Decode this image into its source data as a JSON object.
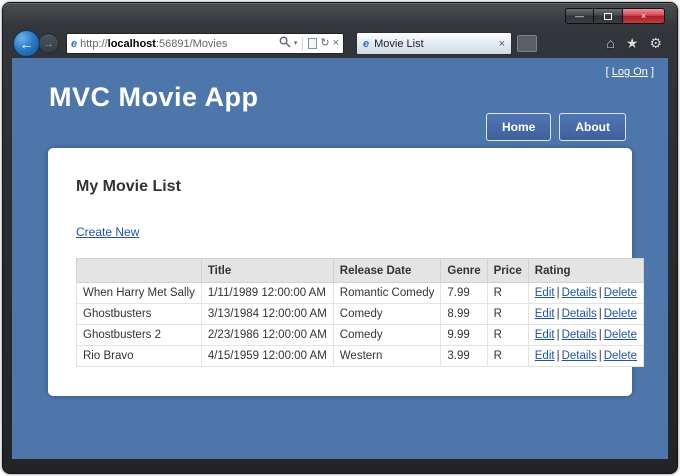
{
  "icons": {
    "minimize": "—",
    "close": "×",
    "back": "←",
    "forward": "→",
    "dropdown": "▾",
    "refresh": "↻",
    "stop": "×",
    "home": "⌂",
    "favorites": "★",
    "tools": "⚙",
    "tab_close": "×",
    "ie_favicon": "e"
  },
  "browser": {
    "address": {
      "protocol": "http://",
      "host": "localhost",
      "path": ":56891/Movies"
    },
    "tab_title": "Movie List"
  },
  "colors": {
    "page_background": "#4d76ab",
    "link_blue": "#2054a3",
    "nav_button": "#3f5f9b",
    "close_button_red": "#d4494f"
  },
  "page": {
    "logon": {
      "open": "[",
      "label": "Log On",
      "close": "]"
    },
    "app_title": "MVC Movie App",
    "nav": {
      "home": "Home",
      "about": "About"
    },
    "content": {
      "heading": "My Movie List",
      "create_link": "Create New",
      "table": {
        "headers": [
          "",
          "Title",
          "Release Date",
          "Genre",
          "Price",
          "Rating"
        ],
        "separator": "|",
        "actions": [
          "Edit",
          "Details",
          "Delete"
        ],
        "rows": [
          {
            "name": "When Harry Met Sally",
            "date": "1/11/1989 12:00:00 AM",
            "genre": "Romantic Comedy",
            "price": "7.99",
            "rating": "R"
          },
          {
            "name": "Ghostbusters",
            "date": "3/13/1984 12:00:00 AM",
            "genre": "Comedy",
            "price": "8.99",
            "rating": "R"
          },
          {
            "name": "Ghostbusters 2",
            "date": "2/23/1986 12:00:00 AM",
            "genre": "Comedy",
            "price": "9.99",
            "rating": "R"
          },
          {
            "name": "Rio Bravo",
            "date": "4/15/1959 12:00:00 AM",
            "genre": "Western",
            "price": "3.99",
            "rating": "R"
          }
        ]
      }
    }
  }
}
